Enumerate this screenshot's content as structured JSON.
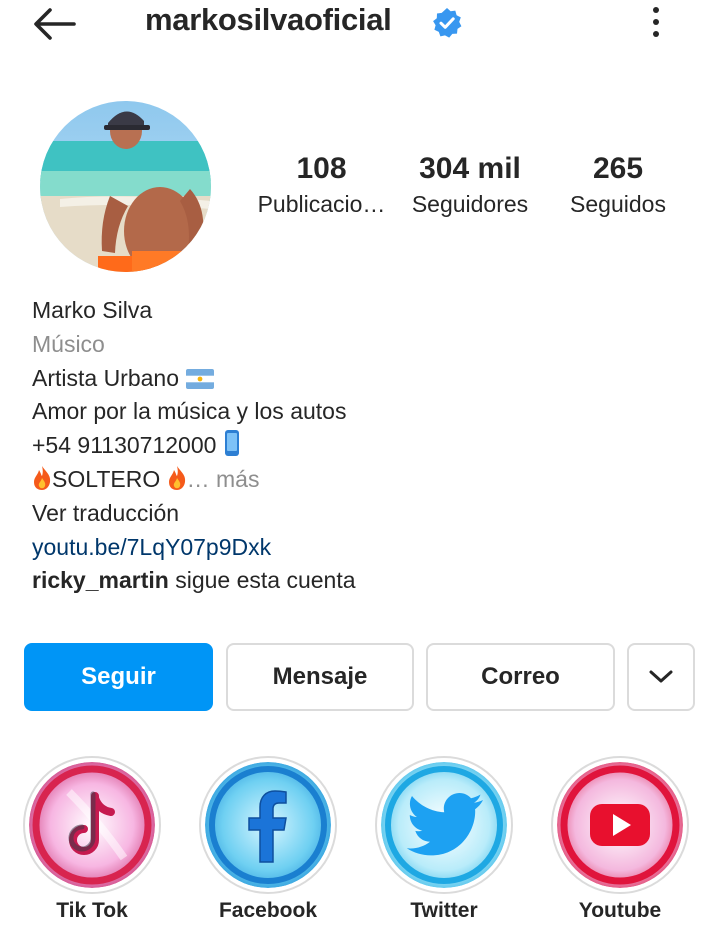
{
  "header": {
    "username": "markosilvaoficial",
    "back_icon": "arrow-left-icon",
    "verified_icon": "verified-badge-icon",
    "menu_icon": "kebab-menu-icon"
  },
  "stats": [
    {
      "value": "108",
      "label": "Publicacio…"
    },
    {
      "value": "304 mil",
      "label": "Seguidores"
    },
    {
      "value": "265",
      "label": "Seguidos"
    }
  ],
  "bio": {
    "name": "Marko Silva",
    "category": "Músico",
    "line1": "Artista Urbano",
    "line2": "Amor por la música y los autos",
    "phone": "+54 91130712000",
    "status": "SOLTERO",
    "more": "… más",
    "translate": "Ver traducción",
    "link": "youtu.be/7LqY07p9Dxk",
    "followed_by_user": "ricky_martin",
    "followed_by_text": "sigue esta cuenta"
  },
  "actions": {
    "follow": "Seguir",
    "message": "Mensaje",
    "mail": "Correo",
    "more_icon": "chevron-down-icon"
  },
  "highlights": [
    {
      "label": "Tik Tok",
      "icon": "tiktok-icon"
    },
    {
      "label": "Facebook",
      "icon": "facebook-icon"
    },
    {
      "label": "Twitter",
      "icon": "twitter-icon"
    },
    {
      "label": "Youtube",
      "icon": "youtube-icon"
    }
  ],
  "colors": {
    "primary_button": "#0095f6",
    "verified": "#3897f0",
    "link": "#00376b",
    "muted_text": "#8e8e8e"
  }
}
